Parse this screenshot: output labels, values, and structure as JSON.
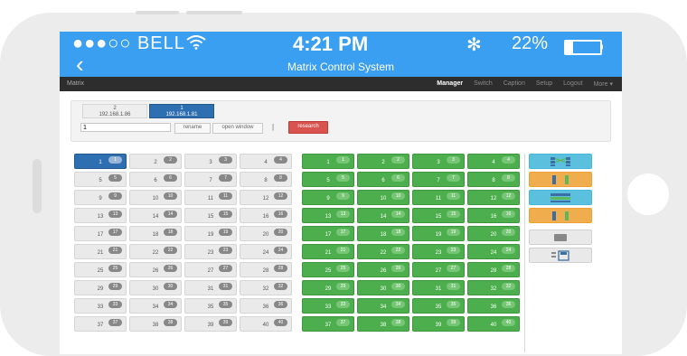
{
  "status_bar": {
    "carrier": "●●●○○ BELL",
    "wifi_icon": "wifi-icon",
    "time": "4:21 PM",
    "bluetooth": "✻",
    "battery_percent": "22%",
    "battery_level": 0.22
  },
  "header": {
    "back": "‹",
    "title": "Matrix Control System"
  },
  "navbar": {
    "brand": "Matrix",
    "links": [
      "Manager",
      "Switch",
      "Caption",
      "Setup",
      "Logout",
      "More ▾"
    ],
    "active": "Manager"
  },
  "ip_tabs": [
    {
      "num": "2",
      "ip": "192.168.1.86"
    },
    {
      "num": "1",
      "ip": "192.168.1.81"
    }
  ],
  "toolbar": {
    "input_value": "1",
    "rename": "rename",
    "open_window": "open window",
    "separator": "|",
    "research": "research"
  },
  "inputs": [
    "1",
    "2",
    "3",
    "4",
    "5",
    "6",
    "7",
    "8",
    "9",
    "10",
    "11",
    "12",
    "13",
    "14",
    "15",
    "16",
    "17",
    "18",
    "19",
    "20",
    "21",
    "22",
    "23",
    "24",
    "25",
    "26",
    "27",
    "28",
    "29",
    "30",
    "31",
    "32",
    "33",
    "34",
    "35",
    "36",
    "37",
    "38",
    "39",
    "40"
  ],
  "outputs": [
    "1",
    "2",
    "3",
    "4",
    "5",
    "6",
    "7",
    "8",
    "9",
    "10",
    "11",
    "12",
    "13",
    "14",
    "15",
    "16",
    "17",
    "18",
    "19",
    "20",
    "21",
    "22",
    "23",
    "24",
    "25",
    "26",
    "27",
    "28",
    "29",
    "30",
    "31",
    "32",
    "33",
    "34",
    "35",
    "36",
    "37",
    "38",
    "39",
    "40"
  ],
  "side_buttons": [
    "matrix-all-icon",
    "matrix-row-icon",
    "matrix-grid-icon",
    "matrix-row-icon",
    "scene-icon",
    "list-save-icon"
  ],
  "colors": {
    "status_bar": "#3a9ff0",
    "selected_input": "#2d6fb0",
    "output": "#4cae4c",
    "research": "#d9534f",
    "side_blue": "#5bc0de",
    "side_orange": "#f0ad4e"
  }
}
